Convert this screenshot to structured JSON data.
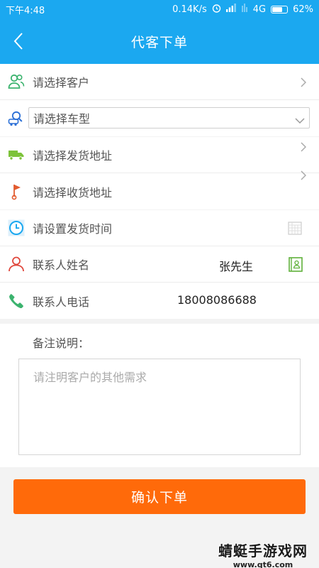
{
  "status_bar": {
    "time": "下午4:48",
    "network_speed": "0.14K/s",
    "network_type": "4G",
    "battery": "62%"
  },
  "header": {
    "title": "代客下单"
  },
  "form": {
    "customer": {
      "label": "请选择客户"
    },
    "vehicle_type": {
      "selected": "请选择车型"
    },
    "ship_address": {
      "label": "请选择发货地址"
    },
    "receive_address": {
      "label": "请选择收货地址"
    },
    "ship_time": {
      "label": "请设置发货时间"
    },
    "contact_name": {
      "label": "联系人姓名",
      "value": "张先生"
    },
    "contact_phone": {
      "label": "联系人电话",
      "value": "18008086688"
    },
    "remark": {
      "label": "备注说明：",
      "placeholder": "请注明客户的其他需求"
    }
  },
  "actions": {
    "confirm_label": "确认下单"
  },
  "watermark": {
    "main": "蜻蜓手游戏网",
    "sub": "www.qt6.com"
  },
  "colors": {
    "primary": "#1ba8f0",
    "accent": "#ff6a0a"
  },
  "icons": [
    "back-arrow-icon",
    "users-icon",
    "car-search-icon",
    "truck-icon",
    "flag-icon",
    "clock-icon",
    "calendar-icon",
    "person-icon",
    "contact-book-icon",
    "phone-icon",
    "chevron-right-icon",
    "dropdown-icon"
  ]
}
